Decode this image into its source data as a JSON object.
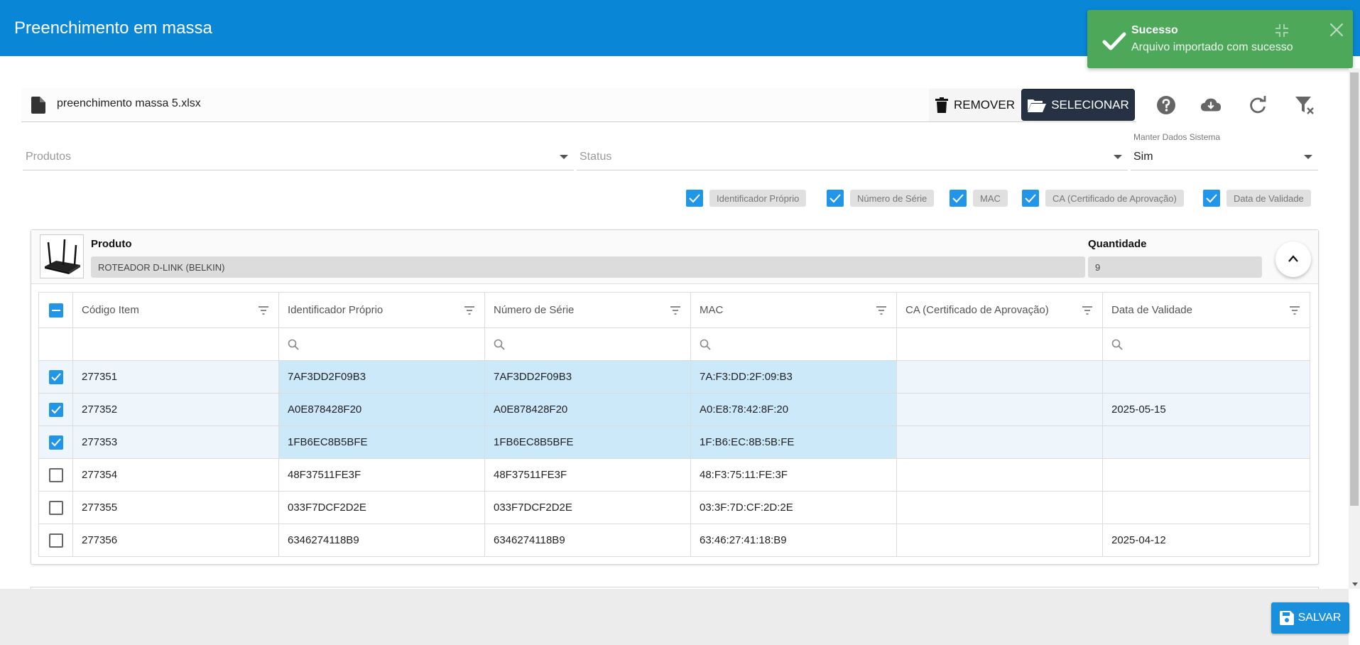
{
  "header": {
    "title": "Preenchimento em massa"
  },
  "toast": {
    "title": "Sucesso",
    "message": "Arquivo importado com sucesso",
    "icon": "check-icon"
  },
  "file": {
    "name": "preenchimento massa 5.xlsx",
    "remove_label": "REMOVER",
    "select_label": "SELECIONAR"
  },
  "filters": {
    "produtos_placeholder": "Produtos",
    "status_placeholder": "Status",
    "manter_label": "Manter Dados Sistema",
    "manter_value": "Sim"
  },
  "column_toggles": [
    {
      "label": "Identificador Próprio",
      "checked": true
    },
    {
      "label": "Número de Série",
      "checked": true
    },
    {
      "label": "MAC",
      "checked": true
    },
    {
      "label": "CA (Certificado de Aprovação)",
      "checked": true
    },
    {
      "label": "Data de Validade",
      "checked": true
    }
  ],
  "product": {
    "label": "Produto",
    "value": "ROTEADOR D-LINK (BELKIN)",
    "qty_label": "Quantidade",
    "qty_value": "9"
  },
  "grid": {
    "columns": [
      "Código Item",
      "Identificador Próprio",
      "Número de Série",
      "MAC",
      "CA (Certificado de Aprovação)",
      "Data de Validade"
    ],
    "rows": [
      {
        "selected": true,
        "codigo": "277351",
        "ident": "7AF3DD2F09B3",
        "serie": "7AF3DD2F09B3",
        "mac": "7A:F3:DD:2F:09:B3",
        "ca": "",
        "validade": ""
      },
      {
        "selected": true,
        "codigo": "277352",
        "ident": "A0E878428F20",
        "serie": "A0E878428F20",
        "mac": "A0:E8:78:42:8F:20",
        "ca": "",
        "validade": "2025-05-15"
      },
      {
        "selected": true,
        "codigo": "277353",
        "ident": "1FB6EC8B5BFE",
        "serie": "1FB6EC8B5BFE",
        "mac": "1F:B6:EC:8B:5B:FE",
        "ca": "",
        "validade": ""
      },
      {
        "selected": false,
        "codigo": "277354",
        "ident": "48F37511FE3F",
        "serie": "48F37511FE3F",
        "mac": "48:F3:75:11:FE:3F",
        "ca": "",
        "validade": ""
      },
      {
        "selected": false,
        "codigo": "277355",
        "ident": "033F7DCF2D2E",
        "serie": "033F7DCF2D2E",
        "mac": "03:3F:7D:CF:2D:2E",
        "ca": "",
        "validade": ""
      },
      {
        "selected": false,
        "codigo": "277356",
        "ident": "6346274118B9",
        "serie": "6346274118B9",
        "mac": "63:46:27:41:18:B9",
        "ca": "",
        "validade": "2025-04-12"
      }
    ]
  },
  "footer": {
    "save_label": "SALVAR"
  },
  "colors": {
    "header": "#0a86d6",
    "toast": "#4da85a",
    "accent": "#2196e8",
    "dark_button": "#263244",
    "row_highlight": "#cce9fa"
  }
}
